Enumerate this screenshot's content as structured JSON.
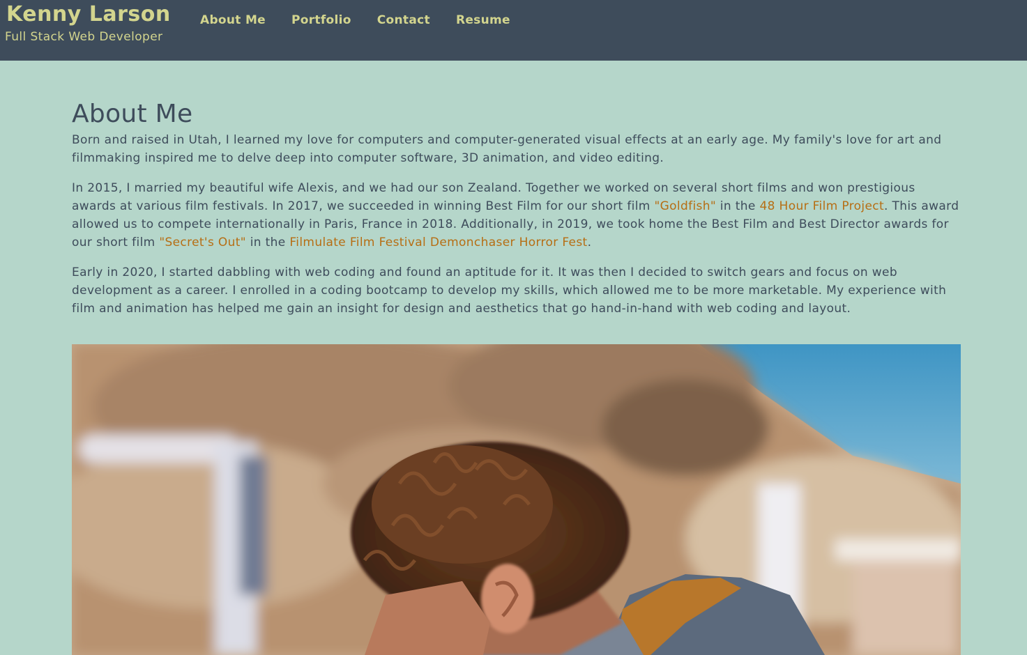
{
  "header": {
    "name": "Kenny Larson",
    "tagline": "Full Stack Web Developer",
    "nav": [
      "About Me",
      "Portfolio",
      "Contact",
      "Resume"
    ]
  },
  "main": {
    "title": "About Me",
    "p1": "Born and raised in Utah, I learned my love for computers and computer-generated visual effects at an early age. My family's love for art and filmmaking inspired me to delve deep into computer software, 3D animation, and video editing.",
    "p2": {
      "t1": "In 2015, I married my beautiful wife Alexis, and we had our son Zealand. Together we worked on several short films and won prestigious awards at various film festivals. In 2017, we succeeded in winning Best Film for our short film ",
      "link1": "\"Goldfish\"",
      "t2": " in the ",
      "link2": "48 Hour Film Project",
      "t3": ". This award allowed us to compete internationally in Paris, France in 2018. Additionally, in 2019, we took home the Best Film and Best Director awards for our short film ",
      "link3": "\"Secret's Out\"",
      "t4": " in the ",
      "link4": "Filmulate Film Festival Demonchaser Horror Fest",
      "t5": "."
    },
    "p3": "Early in 2020, I started dabbling with web coding and found an aptitude for it. It was then I decided to switch gears and focus on web development as a career. I enrolled in a coding bootcamp to develop my skills, which allowed me to be more marketable. My experience with film and animation has helped me gain an insight for design and aesthetics that go hand-in-hand with web coding and layout."
  },
  "colors": {
    "header_bg": "#3e4c5b",
    "page_bg": "#b5d6ca",
    "accent_text": "#d3d58e",
    "body_text": "#3e4c5b",
    "link": "#b66e14"
  }
}
